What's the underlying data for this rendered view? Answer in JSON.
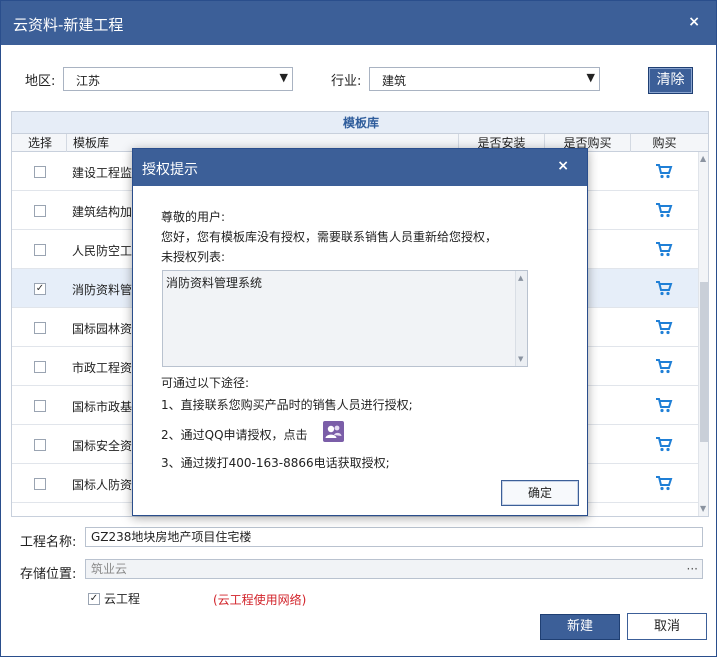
{
  "window": {
    "title": "云资料-新建工程",
    "close_label": "×"
  },
  "filters": {
    "region_label": "地区:",
    "region_value": "江苏",
    "industry_label": "行业:",
    "industry_value": "建筑",
    "clear_label": "清除"
  },
  "table": {
    "caption": "模板库",
    "columns": [
      "选择",
      "模板库",
      "是否安装",
      "是否购买",
      "购买"
    ],
    "rows": [
      {
        "name": "建设工程监",
        "checked": false
      },
      {
        "name": "建筑结构加",
        "checked": false
      },
      {
        "name": "人民防空工",
        "checked": false
      },
      {
        "name": "消防资料管",
        "checked": true
      },
      {
        "name": "国标园林资",
        "checked": false
      },
      {
        "name": "市政工程资",
        "checked": false
      },
      {
        "name": "国标市政基",
        "checked": false
      },
      {
        "name": "国标安全资",
        "checked": false
      },
      {
        "name": "国标人防资",
        "checked": false
      }
    ]
  },
  "form": {
    "project_name_label": "工程名称:",
    "project_name_value": "GZ238地块房地产项目住宅楼",
    "storage_label": "存储位置:",
    "storage_value": "筑业云",
    "storage_browse": "···",
    "cloud_label": "云工程",
    "cloud_checked": true,
    "cloud_hint": "(云工程使用网络)",
    "new_label": "新建",
    "cancel_label": "取消"
  },
  "modal": {
    "title": "授权提示",
    "close_label": "×",
    "greeting": "尊敬的用户:",
    "message": "您好，您有模板库没有授权，需要联系销售人员重新给您授权，",
    "list_label": "未授权列表:",
    "unauthorized_items": [
      "消防资料管理系统"
    ],
    "ways_label": "可通过以下途径:",
    "way1": "1、直接联系您购买产品时的销售人员进行授权;",
    "way2": "2、通过QQ申请授权，点击",
    "way3": "3、通过拨打400-163-8866电话获取授权;",
    "ok_label": "确定"
  },
  "colors": {
    "accent": "#3c5f98",
    "hint": "#d2232a",
    "cart": "#1f7fd6"
  }
}
